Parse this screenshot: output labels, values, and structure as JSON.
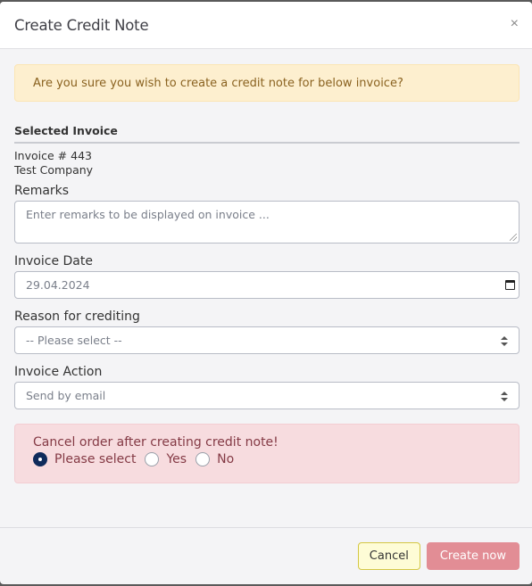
{
  "modal": {
    "title": "Create Credit Note",
    "close_icon": "close-icon",
    "close_glyph": "×"
  },
  "warning": {
    "text": "Are you sure you wish to create a credit note for below invoice?",
    "color": "#fdefcf"
  },
  "selected_invoice": {
    "heading": "Selected Invoice",
    "invoice_number": "Invoice # 443",
    "company": "Test Company"
  },
  "form": {
    "remarks": {
      "label": "Remarks",
      "value": "",
      "placeholder": "Enter remarks to be displayed on invoice ..."
    },
    "invoice_date": {
      "label": "Invoice Date",
      "value": "29.04.2024",
      "icon": "calendar-icon"
    },
    "reason": {
      "label": "Reason for crediting",
      "selected": "-- Please select --"
    },
    "invoice_action": {
      "label": "Invoice Action",
      "selected": "Send by email"
    }
  },
  "cancel_order": {
    "text": "Cancel order after creating credit note!",
    "options": [
      {
        "label": "Please select",
        "checked": true
      },
      {
        "label": "Yes",
        "checked": false
      },
      {
        "label": "No",
        "checked": false
      }
    ],
    "color": "#f7dcdf"
  },
  "footer": {
    "cancel_label": "Cancel",
    "create_label": "Create now",
    "create_color": "#e28d95",
    "cancel_color": "#fefcd6"
  }
}
